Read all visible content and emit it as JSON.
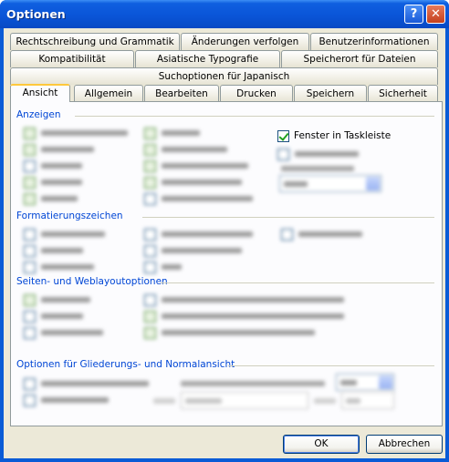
{
  "window": {
    "title": "Optionen",
    "help_button": "?",
    "close_button": "✕"
  },
  "tabs": {
    "row1": [
      "Rechtschreibung und Grammatik",
      "Änderungen verfolgen",
      "Benutzerinformationen"
    ],
    "row2": [
      "Kompatibilität",
      "Asiatische Typografie",
      "Speicherort für Dateien"
    ],
    "row3": [
      "Suchoptionen für Japanisch"
    ],
    "row4": [
      "Ansicht",
      "Allgemein",
      "Bearbeiten",
      "Drucken",
      "Speichern",
      "Sicherheit"
    ],
    "active": "Ansicht"
  },
  "sections": {
    "anzeigen": "Anzeigen",
    "formatierungszeichen": "Formatierungszeichen",
    "seiten_weblayout": "Seiten- und Weblayoutoptionen",
    "gliederung": "Optionen für Gliederungs- und Normalansicht"
  },
  "visible_option": {
    "label": "Fenster in Taskleiste",
    "checked": true
  },
  "buttons": {
    "ok": "OK",
    "cancel": "Abbrechen"
  }
}
